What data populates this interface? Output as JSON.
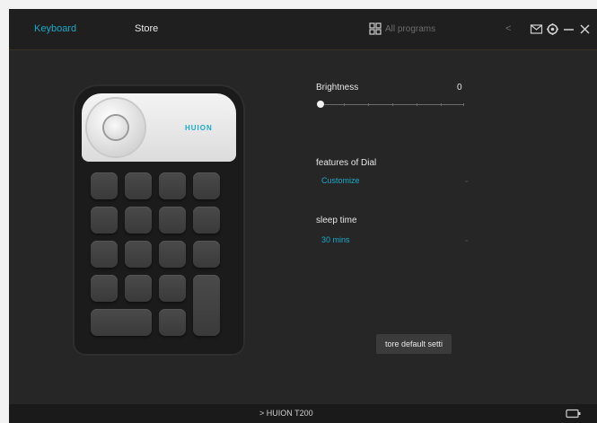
{
  "tabs": [
    {
      "label": "Keyboard",
      "active": true
    },
    {
      "label": "Store",
      "active": false
    }
  ],
  "programs": {
    "icon": "grid-icon",
    "selected": "All programs",
    "arrow": "<"
  },
  "window_icons": [
    "mail-icon",
    "settings-icon",
    "minimize-icon",
    "close-icon"
  ],
  "device": {
    "brand": "HUION"
  },
  "settings": {
    "brightness": {
      "label": "Brightness",
      "value": "0",
      "level": 0
    },
    "dial": {
      "label": "features of Dial",
      "value": "Customize"
    },
    "sleep": {
      "label": "sleep time",
      "value": "30 mins"
    },
    "restore_label": "tore default setti"
  },
  "statusbar": {
    "device_name": "> HUION T200",
    "battery_icon": "battery-icon"
  },
  "colors": {
    "accent": "#1aa9c7",
    "background": "#262626",
    "topbar": "#1f1f1f"
  }
}
